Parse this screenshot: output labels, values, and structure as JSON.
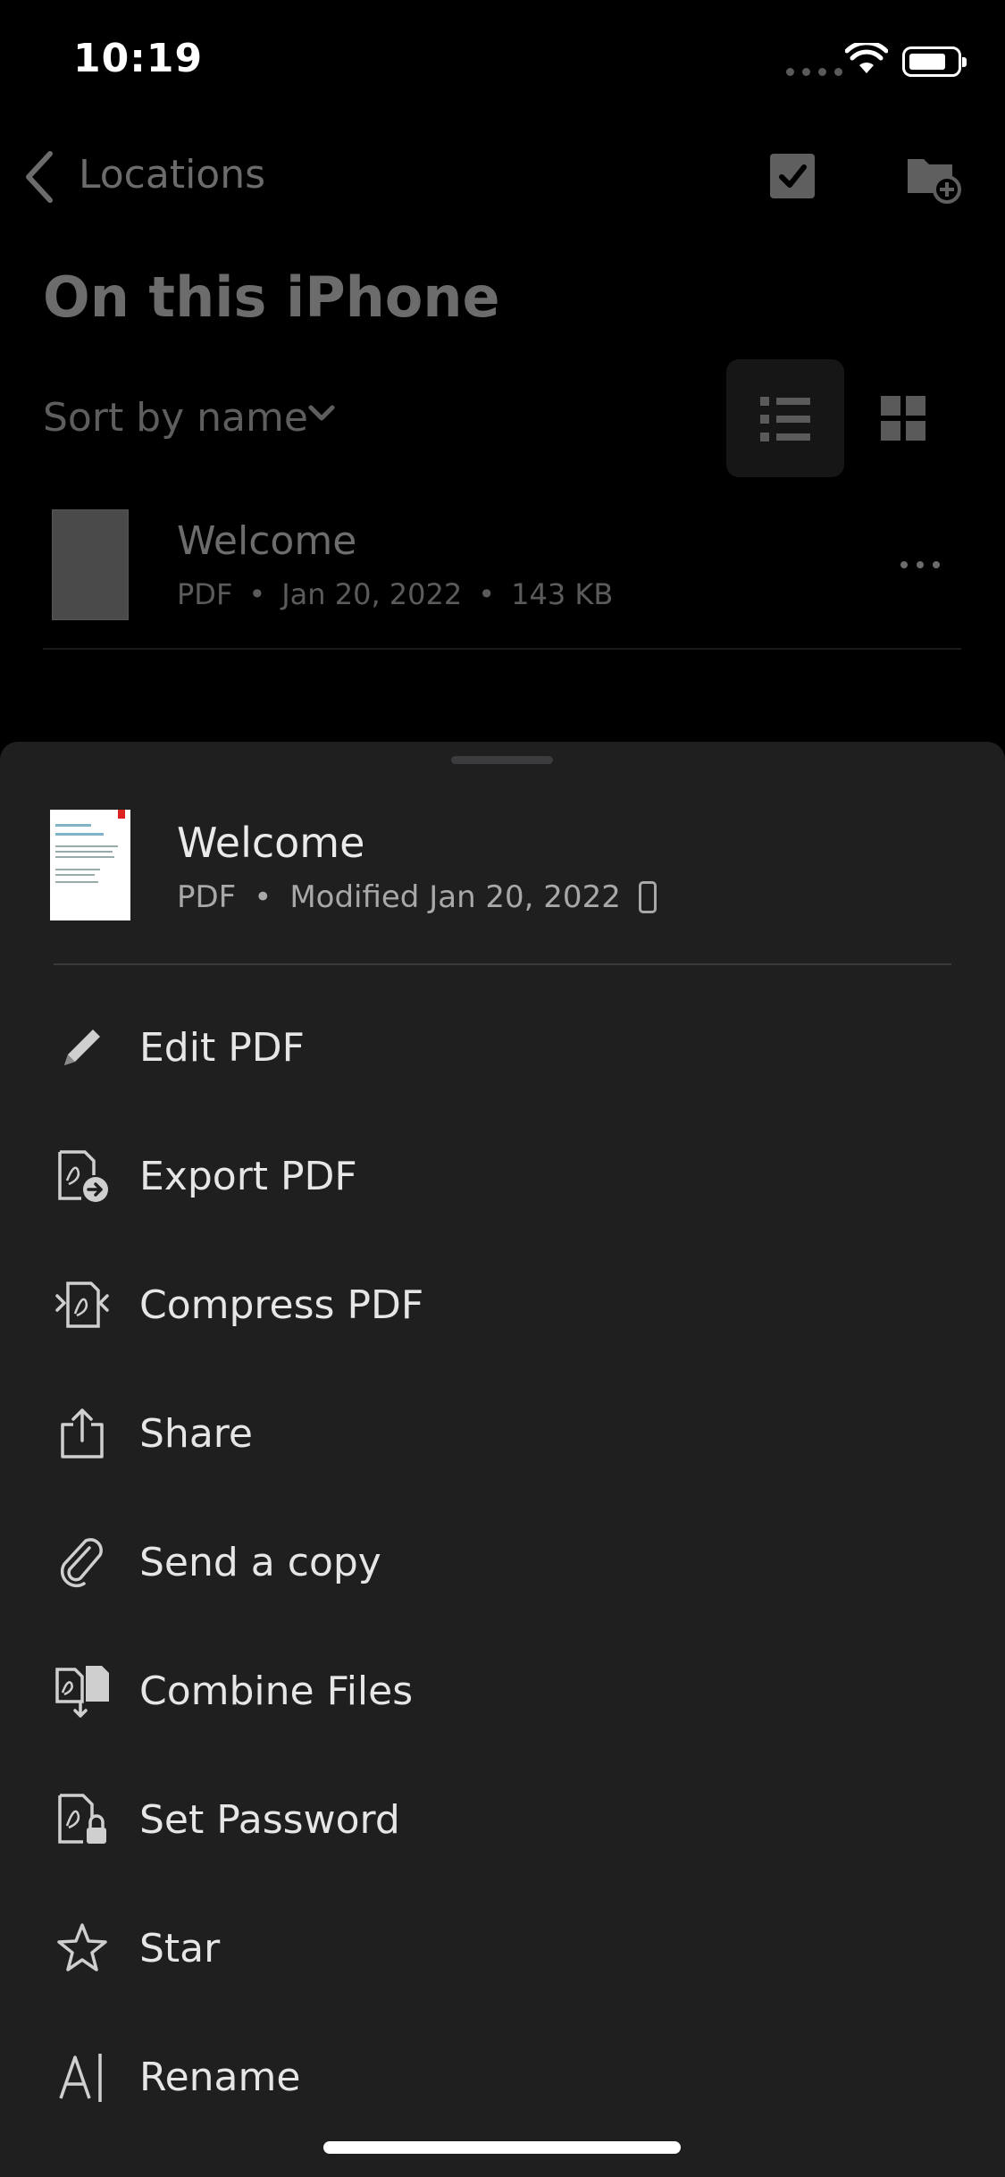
{
  "status_bar": {
    "time": "10:19"
  },
  "nav": {
    "back_label": "Locations"
  },
  "page": {
    "title": "On this iPhone",
    "sort_label": "Sort by name"
  },
  "file": {
    "name": "Welcome",
    "type": "PDF",
    "date": "Jan 20, 2022",
    "size": "143 KB"
  },
  "sheet": {
    "file_name": "Welcome",
    "file_type": "PDF",
    "modified": "Modified Jan 20, 2022",
    "menu": [
      {
        "label": "Edit PDF",
        "icon": "pencil-icon"
      },
      {
        "label": "Export PDF",
        "icon": "export-pdf-icon"
      },
      {
        "label": "Compress PDF",
        "icon": "compress-pdf-icon"
      },
      {
        "label": "Share",
        "icon": "share-icon"
      },
      {
        "label": "Send a copy",
        "icon": "paperclip-icon"
      },
      {
        "label": "Combine Files",
        "icon": "combine-files-icon"
      },
      {
        "label": "Set Password",
        "icon": "lock-pdf-icon"
      },
      {
        "label": "Star",
        "icon": "star-icon"
      },
      {
        "label": "Rename",
        "icon": "rename-icon"
      }
    ]
  },
  "colors": {
    "sheet_bg": "#1f1f20",
    "text": "#e6e6e6",
    "muted": "#a8a8a8",
    "dim": "#6c6c6c"
  }
}
